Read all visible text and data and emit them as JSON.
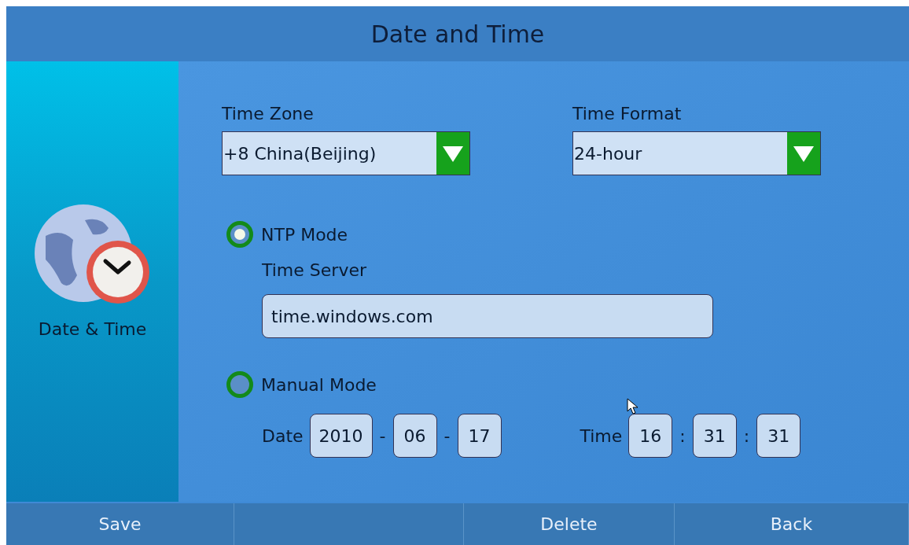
{
  "title": "Date and Time",
  "sidebar": {
    "label": "Date & Time"
  },
  "time_zone": {
    "label": "Time Zone",
    "value": "+8 China(Beijing)"
  },
  "time_format": {
    "label": "Time Format",
    "value": "24-hour"
  },
  "modes": [
    {
      "label": "NTP Mode",
      "selected": true
    },
    {
      "label": "Manual Mode",
      "selected": false
    }
  ],
  "time_server": {
    "label": "Time Server",
    "value": "time.windows.com"
  },
  "date": {
    "label": "Date",
    "parts": [
      {
        "kind": "field",
        "value": "2010"
      },
      {
        "kind": "sep",
        "text": "-"
      },
      {
        "kind": "field",
        "value": "06"
      },
      {
        "kind": "sep",
        "text": "-"
      },
      {
        "kind": "field",
        "value": "17"
      }
    ]
  },
  "time": {
    "label": "Time",
    "parts": [
      {
        "kind": "field",
        "value": "16"
      },
      {
        "kind": "sep",
        "text": ":"
      },
      {
        "kind": "field",
        "value": "31"
      },
      {
        "kind": "sep",
        "text": ":"
      },
      {
        "kind": "field",
        "value": "31"
      }
    ]
  },
  "softkeys": [
    {
      "kind": "button",
      "label": "Save"
    },
    {
      "kind": "blank"
    },
    {
      "kind": "button",
      "label": "Delete"
    },
    {
      "kind": "button",
      "label": "Back"
    }
  ]
}
